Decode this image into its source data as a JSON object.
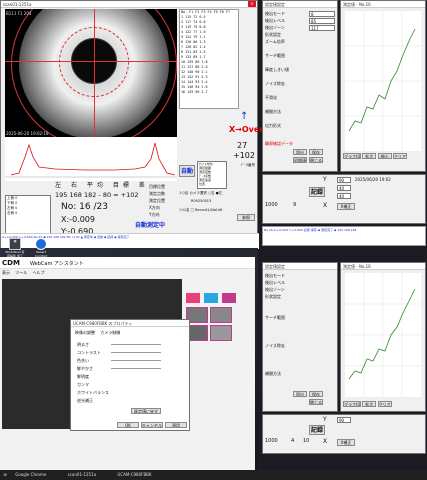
{
  "scope_window": {
    "title": "scan01-1251a",
    "header_left": "B111 F1 204",
    "timestamp": "2025-06-20 19:02:18",
    "x_value": "-0.009",
    "y_value": "+0.003"
  },
  "table": {
    "header": "No.  F1  F2  F3  F4  F5  F6  F7",
    "rows": [
      "1 115 72 0.5",
      "2 117 74 0.6",
      "3 119 75 0.8",
      "4 122 77 1.0",
      "5 124 79 1.1",
      "6 126 80 1.3",
      "7 128 82 1.4",
      "8 131 83 1.5",
      "9 133 85 1.7",
      "10 135 86 1.8",
      "11 137 88 2.0",
      "12 140 90 2.1",
      "13 142 91 2.3",
      "14 144 93 2.4",
      "15 146 94 2.6",
      "16 149 96 2.7"
    ]
  },
  "status": {
    "xover": "X→Over",
    "val1": "27",
    "val2": "+102",
    "label": "ﾃﾞｰﾀ番号"
  },
  "auto": {
    "button": "自動",
    "note": "自動測定中"
  },
  "readout": {
    "headers": [
      "左",
      "右",
      "平均",
      "目標",
      "差"
    ],
    "values": "195 168 182 - 80 = +102",
    "no": "No: 16 /23",
    "x": "X:-0.009",
    "y": "Y:-0.690"
  },
  "right_labels": [
    "目標位置",
    "測定点数",
    "測定位置",
    "X方向",
    "Y方向"
  ],
  "webcam": {
    "brand": "CDM",
    "title": "WebCam アシスタント",
    "menu": [
      "表示",
      "ツール",
      "ヘルプ"
    ],
    "dialog_title": "UCAM-C980FBBK のプロパティ",
    "dialog_tabs": [
      "映像の調整",
      "カメラ制御"
    ],
    "sliders": [
      "明るさ",
      "コントラスト",
      "色合い",
      "鮮やかさ",
      "鮮明度",
      "ガンマ",
      "ホワイトバランス",
      "逆光補正"
    ],
    "ok": "OK",
    "cancel": "キャンセル",
    "apply": "適用",
    "defaults": "既定値に戻す"
  },
  "desktop_icons": [
    "PhotoRoid 写真編集 加工",
    "Seaart Comfort Master"
  ],
  "settings_win": {
    "title": "設定値設定",
    "rows": [
      "検出モード",
      "検出レベル",
      "検出ゾーン",
      "形状設定",
      "ズーム倍率",
      "サーチ範囲",
      "輝度しきい値",
      "ノイズ除去",
      "平滑化",
      "補間方法",
      "出力形式"
    ],
    "buttons": [
      "読出",
      "保存",
      "初期値",
      "閉じる"
    ]
  },
  "graph_win": {
    "title": "測定値 - No.16",
    "tabs": [
      "グラフ(0)",
      "拡大",
      "縮小",
      "クリア"
    ]
  },
  "record": {
    "label": "記録",
    "y": "Y",
    "x": "X",
    "vals": [
      "90",
      "40",
      "40"
    ],
    "nums": [
      "1000",
      "9",
      "4",
      "1",
      "10"
    ],
    "xset": "X補正",
    "date": "2025/06/20 19:02"
  },
  "taskbar": {
    "items": [
      "Google Chrome",
      "scan01-1251a",
      "UCAM-C980FBBK"
    ]
  },
  "colors": {
    "accent": "#1b2fd8",
    "alert": "#e00000",
    "ok": "#0a6e0a"
  }
}
